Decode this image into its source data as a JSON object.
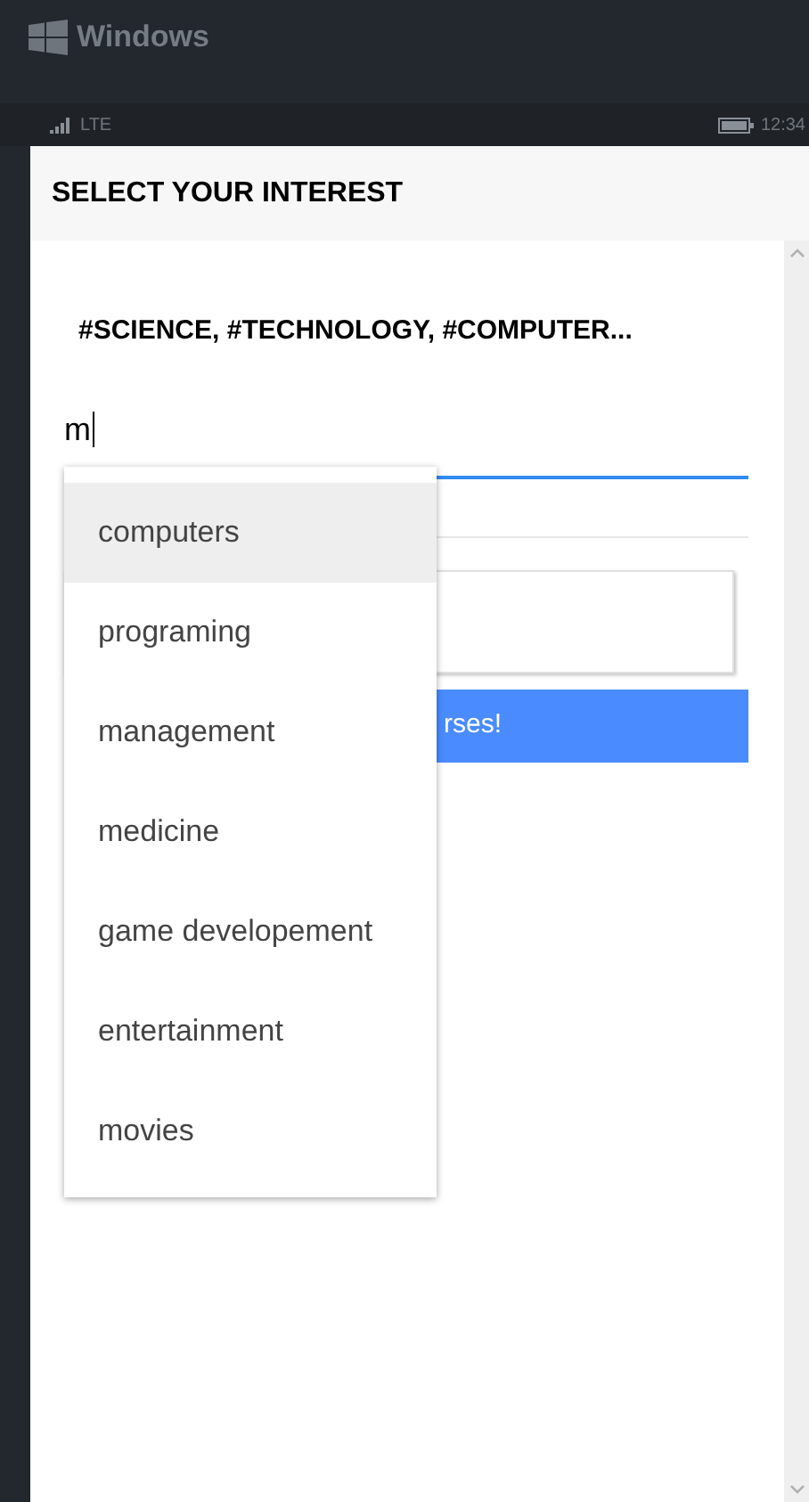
{
  "window": {
    "title": "Windows"
  },
  "status_bar": {
    "network": "LTE",
    "time": "12:34"
  },
  "header": {
    "title": "SELECT YOUR INTEREST"
  },
  "selected_tags": "#SCIENCE, #TECHNOLOGY, #COMPUTER...",
  "search": {
    "value": "m"
  },
  "button": {
    "label": "rses!"
  },
  "suggestions": [
    {
      "label": "computers",
      "selected": true
    },
    {
      "label": "programing",
      "selected": false
    },
    {
      "label": "management",
      "selected": false
    },
    {
      "label": "medicine",
      "selected": false
    },
    {
      "label": "game developement",
      "selected": false
    },
    {
      "label": "entertainment",
      "selected": false
    },
    {
      "label": "movies",
      "selected": false
    }
  ]
}
